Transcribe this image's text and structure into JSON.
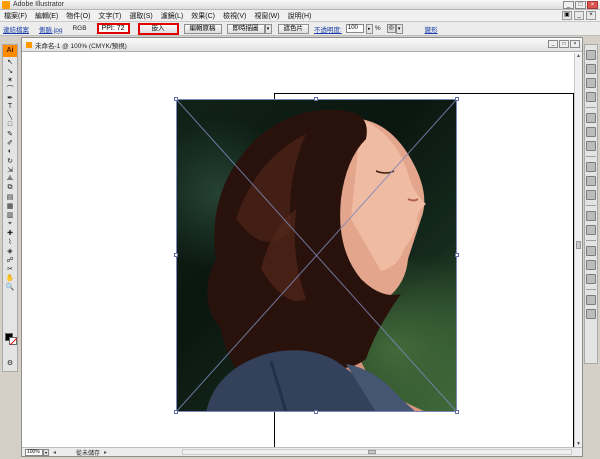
{
  "app": {
    "title": "Adobe Illustrator",
    "window_buttons": [
      "_",
      "□",
      "×"
    ]
  },
  "menu": {
    "items": [
      "檔案(F)",
      "編輯(E)",
      "物件(O)",
      "文字(T)",
      "選取(S)",
      "濾鏡(L)",
      "效果(C)",
      "檢視(V)",
      "視窗(W)",
      "說明(H)"
    ]
  },
  "control_bar": {
    "link_label": "連結檔案",
    "file_name": "側臉.jpg",
    "color_mode": "RGB",
    "ppi": "PPI: 72",
    "embed_button": "嵌入",
    "edit_original_button": "編輯原稿",
    "live_trace_button": "即時描圖",
    "mask_button": "遮色片",
    "opacity_label": "不透明度:",
    "opacity_value": "100",
    "opacity_unit": "%",
    "transform_label": "變形"
  },
  "tools": {
    "logo": "Ai",
    "glyphs": [
      "↖",
      "↘",
      "✶",
      "⌒",
      "✒",
      "T",
      "╲",
      "□",
      "✎",
      "✐",
      "◐",
      "↻",
      "⇲",
      "⟁",
      "⧉",
      "▤",
      "▦",
      "▥",
      "⌖",
      "✚",
      "⌇",
      "◈",
      "☍",
      "✂",
      "✋",
      "🔍",
      "",
      "",
      "",
      "⚙"
    ]
  },
  "document": {
    "title": "未命名-1 @ 100% (CMYK/預視)",
    "buttons": [
      "_",
      "□",
      "×"
    ],
    "zoom": "100%",
    "status": "從未儲存",
    "status_nav_prev": "◂",
    "status_nav_next": "▸"
  },
  "colors": {
    "accent_red": "#e00000",
    "ai_orange": "#ff8c00",
    "bounding_box": "#6070a0"
  }
}
